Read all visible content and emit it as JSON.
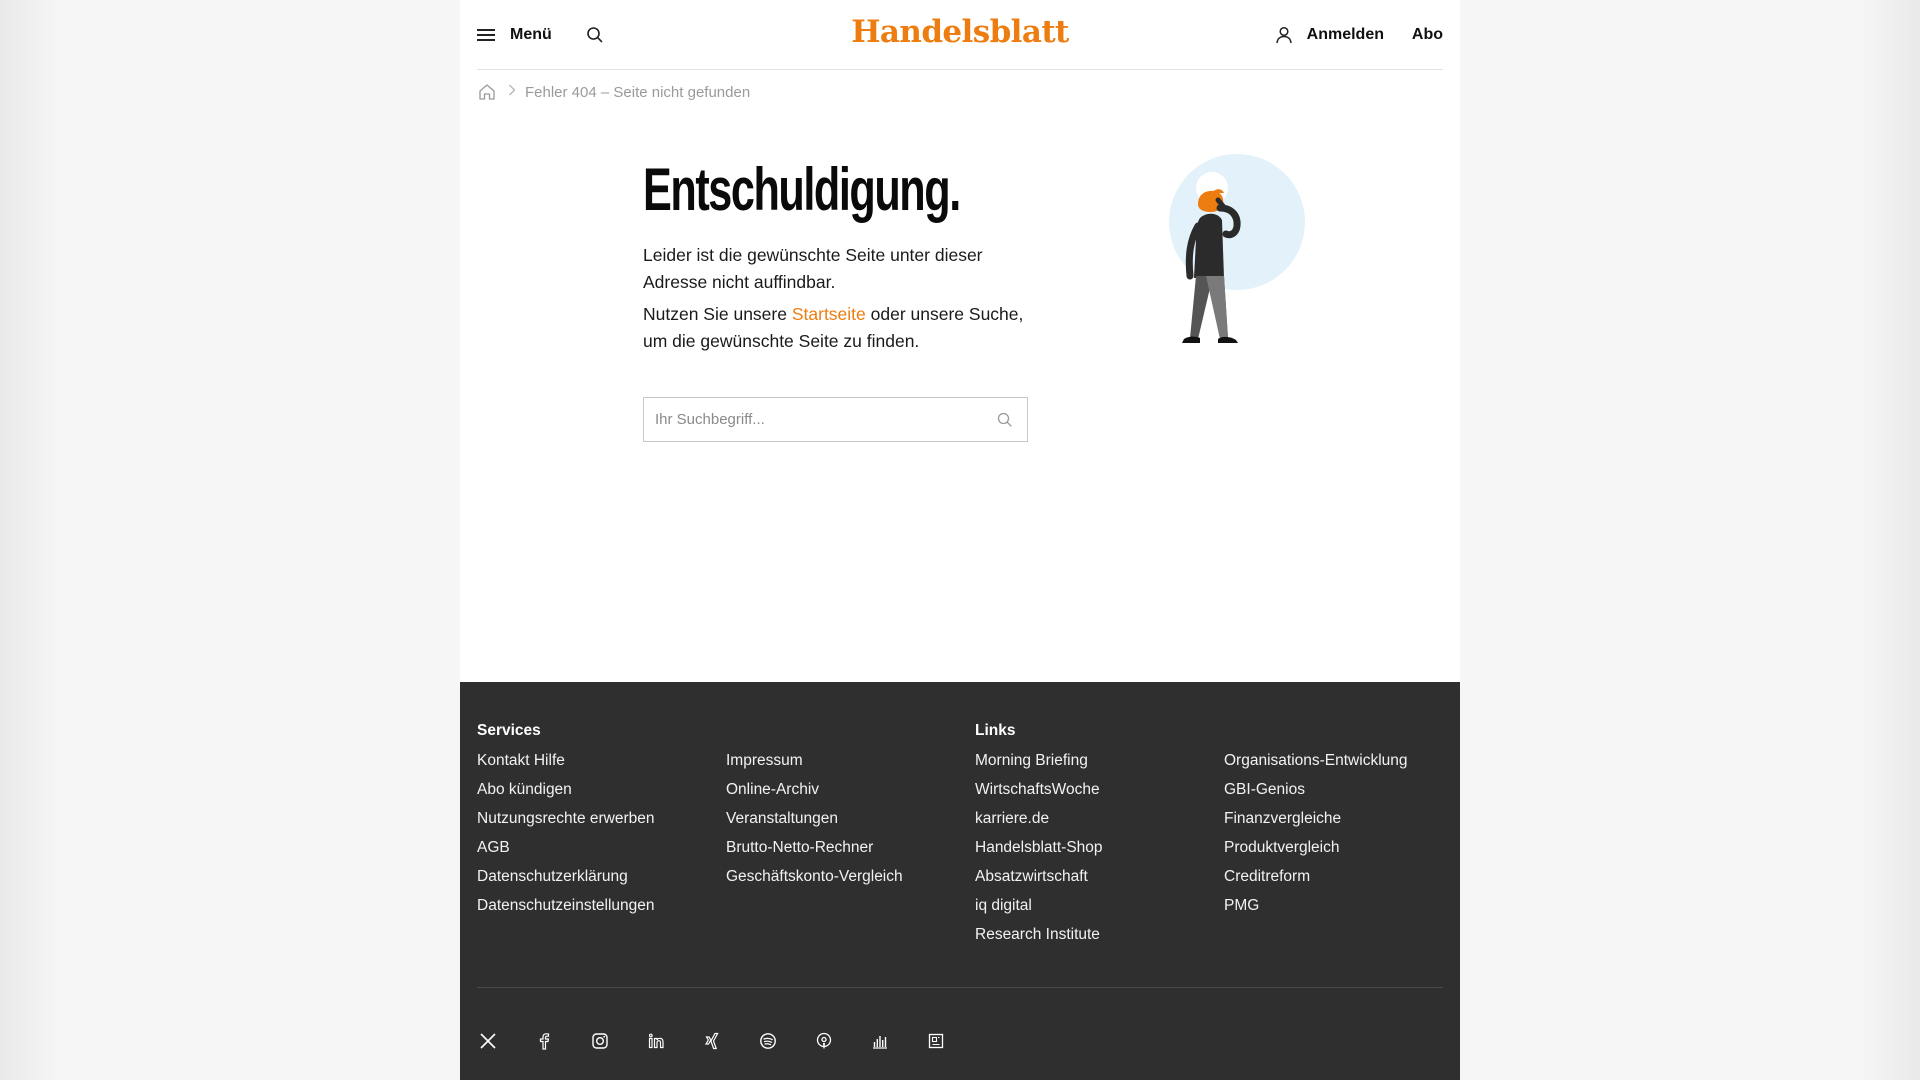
{
  "header": {
    "menu_label": "Menü",
    "logo_text": "Handelsblatt",
    "login_label": "Anmelden",
    "abo_label": "Abo"
  },
  "breadcrumb": {
    "current": "Fehler 404 – Seite nicht gefunden"
  },
  "main": {
    "title": "Entschuldigung.",
    "paragraph1": "Leider ist die gewünschte Seite unter dieser Adresse nicht auffindbar.",
    "paragraph2_before": "Nutzen Sie unsere ",
    "paragraph2_link": "Startseite",
    "paragraph2_after": " oder unsere Suche, um die gewünschte Seite zu finden.",
    "search_placeholder": "Ihr Suchbegriff..."
  },
  "footer": {
    "services_heading": "Services",
    "services_col1": [
      "Kontakt Hilfe",
      "Abo kündigen",
      "Nutzungsrechte erwerben",
      "AGB",
      "Datenschutzerklärung",
      "Datenschutzeinstellungen"
    ],
    "services_col2": [
      "Impressum",
      "Online-Archiv",
      "Veranstaltungen",
      "Brutto-Netto-Rechner",
      "Geschäftskonto-Vergleich"
    ],
    "links_heading": "Links",
    "links_col1": [
      "Morning Briefing",
      "WirtschaftsWoche",
      "karriere.de",
      "Handelsblatt-Shop",
      "Absatzwirtschaft",
      "iq digital",
      "Research Institute"
    ],
    "links_col2": [
      "Organisations-Entwicklung",
      "GBI-Genios",
      "Finanzvergleiche",
      "Produktvergleich",
      "Creditreform",
      "PMG"
    ],
    "social_icons": [
      "x-icon",
      "facebook-icon",
      "instagram-icon",
      "linkedin-icon",
      "xing-icon",
      "spotify-icon",
      "podcast-icon",
      "charts-icon",
      "newsletter-icon"
    ]
  },
  "colors": {
    "brand": "#ee7d11",
    "footer_bg": "#2f2f2f",
    "illustration_circle": "#e3f1fb"
  }
}
